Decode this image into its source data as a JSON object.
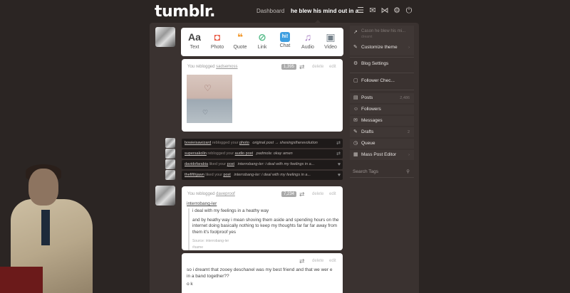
{
  "header": {
    "logo": "tumblr.",
    "dashboard": "Dashboard",
    "blog_title": "he blew his mind out in a...",
    "icons": [
      "list-icon",
      "mail-icon",
      "activity-icon",
      "settings-icon",
      "power-icon"
    ]
  },
  "composer": {
    "types": [
      {
        "label": "Text",
        "icon": "Aa",
        "color": "#444"
      },
      {
        "label": "Photo",
        "icon": "◘",
        "color": "#e8553f"
      },
      {
        "label": "Quote",
        "icon": "❝",
        "color": "#f2992e"
      },
      {
        "label": "Link",
        "icon": "⊘",
        "color": "#56bc8a"
      },
      {
        "label": "Chat",
        "icon": "hi!",
        "color": "#3d9ee0"
      },
      {
        "label": "Audio",
        "icon": "♫",
        "color": "#a77dc2"
      },
      {
        "label": "Video",
        "icon": "▣",
        "color": "#748089"
      }
    ]
  },
  "post1": {
    "prefix": "You reblogged",
    "source": "sadsemoss",
    "notes": "1,395",
    "delete": "delete",
    "edit": "edit"
  },
  "notifications": [
    {
      "user": "bowieisawizard",
      "action": "reblogged your",
      "object": "photo",
      "detail": "original post → shesingstherevolution",
      "icon": "⇄"
    },
    {
      "user": "supersakolin",
      "action": "reblogged your",
      "object": "audio post",
      "detail": "padmola: okay amen",
      "icon": "⇄"
    },
    {
      "user": "davidofarabia",
      "action": "liked your",
      "object": "post",
      "detail": "interrobang-ler: i deal with my feelings in a...",
      "icon": "♥"
    },
    {
      "user": "thefifthjawn",
      "action": "liked your",
      "object": "post",
      "detail": "interrobang-ler: i deal with my feelings in a...",
      "icon": "♥"
    }
  ],
  "post2": {
    "prefix": "You reblogged",
    "source": "daveproof",
    "notes": "7,234",
    "delete": "delete",
    "edit": "edit",
    "quote_user": "interrobang-ler",
    "line1": "i deal with my feelings in a heathy way",
    "line2": "and by heathy way i mean shoving them aside and spending hours on the internet doing basically nothing to keep my thoughts far far far away from them it's foolproof yes",
    "source_label": "Source: interrobang-ler",
    "tag": "#same"
  },
  "post3": {
    "delete": "delete",
    "edit": "edit",
    "line1": "so i dreamt that zooey deschanel was my best friend and that we wer e in a band together??",
    "line2": "o k"
  },
  "sidebar": {
    "blog_top_title": "Cason he blew his mi...",
    "blog_top_sub": "dreamt",
    "customize": "Customize theme",
    "blog_settings": "Blog Settings",
    "follower_check": "Follower Chec...",
    "posts": "Posts",
    "posts_count": "2,486",
    "followers": "Followers",
    "messages": "Messages",
    "drafts": "Drafts",
    "drafts_count": "2",
    "queue": "Queue",
    "mass_post_editor": "Mass Post Editor",
    "search_placeholder": "Search Tags"
  }
}
